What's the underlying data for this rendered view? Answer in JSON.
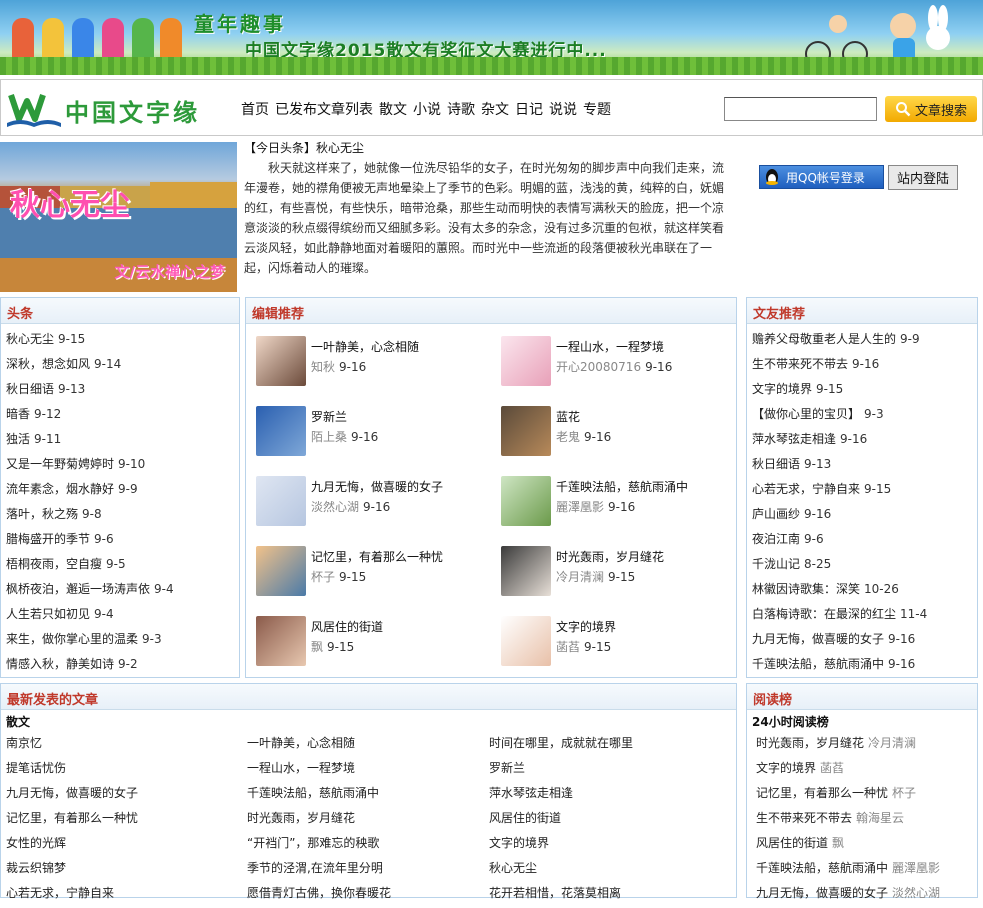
{
  "banner": {
    "title": "童年趣事",
    "subtitle": "中国文字缘2015散文有奖征文大赛进行中..."
  },
  "header": {
    "logo_text": "中国文字缘",
    "nav": [
      "首页",
      "已发布文章列表",
      "散文",
      "小说",
      "诗歌",
      "杂文",
      "日记",
      "说说",
      "专题"
    ],
    "search_placeholder": "",
    "search_button": "文章搜索",
    "qq_login": "用QQ帐号登录",
    "site_login": "站内登陆"
  },
  "headline": {
    "image_title": "秋心无尘",
    "image_author": "文/云水禅心之梦",
    "tag": "【今日头条】秋心无尘",
    "body": "秋天就这样来了，她就像一位洗尽铅华的女子，在时光匆匆的脚步声中向我们走来，流年漫卷，她的襟角便被无声地晕染上了季节的色彩。明媚的蓝，浅浅的黄，纯粹的白，妩媚的红，有些喜悦，有些快乐，暗带沧桑，那些生动而明快的表情写满秋天的脸庞，把一个凉意淡淡的秋点缀得缤纷而又细腻多彩。没有太多的杂念，没有过多沉重的包袱，就这样笑看云淡风轻，如此静静地面对着暖阳的蕙照。而时光中一些流逝的段落便被秋光串联在了一起，闪烁着动人的璀璨。"
  },
  "toutiao": {
    "title": "头条",
    "items": [
      {
        "t": "秋心无尘",
        "d": "9-15"
      },
      {
        "t": "深秋，想念如风",
        "d": "9-14"
      },
      {
        "t": "秋日细语",
        "d": "9-13"
      },
      {
        "t": "暗香",
        "d": "9-12"
      },
      {
        "t": "独活",
        "d": "9-11"
      },
      {
        "t": "又是一年野菊娉婷时",
        "d": "9-10"
      },
      {
        "t": "流年素念，烟水静好",
        "d": "9-9"
      },
      {
        "t": "落叶，秋之殇",
        "d": "9-8"
      },
      {
        "t": "腊梅盛开的季节",
        "d": "9-6"
      },
      {
        "t": "梧桐夜雨，空自瘦",
        "d": "9-5"
      },
      {
        "t": "枫桥夜泊，邂逅一场涛声依",
        "d": "9-4"
      },
      {
        "t": "人生若只如初见",
        "d": "9-4"
      },
      {
        "t": "来生，做你掌心里的温柔",
        "d": "9-3"
      },
      {
        "t": "情感入秋，静美如诗",
        "d": "9-2"
      }
    ]
  },
  "editor": {
    "title": "编辑推荐",
    "items": [
      {
        "t": "一叶静美，心念相随",
        "a": "知秋",
        "d": "9-16"
      },
      {
        "t": "一程山水，一程梦境",
        "a": "开心20080716",
        "d": "9-16"
      },
      {
        "t": "罗新兰",
        "a": "陌上桑",
        "d": "9-16"
      },
      {
        "t": "蓝花",
        "a": "老鬼",
        "d": "9-16"
      },
      {
        "t": "九月无悔，做喜暖的女子",
        "a": "淡然心湖",
        "d": "9-16"
      },
      {
        "t": "千莲映法船，慈航雨涌中",
        "a": "麗澤凰影",
        "d": "9-16"
      },
      {
        "t": "记忆里，有着那么一种忧",
        "a": "杯子",
        "d": "9-15"
      },
      {
        "t": "时光轰雨，岁月缝花",
        "a": "冷月清澜",
        "d": "9-15"
      },
      {
        "t": "风居住的街道",
        "a": "飘",
        "d": "9-15"
      },
      {
        "t": "文字的境界",
        "a": "菡萏",
        "d": "9-15"
      }
    ]
  },
  "friends": {
    "title": "文友推荐",
    "items": [
      {
        "t": "赡养父母敬重老人是人生的",
        "d": "9-9"
      },
      {
        "t": "生不带来死不带去",
        "d": "9-16"
      },
      {
        "t": "文字的境界",
        "d": "9-15"
      },
      {
        "t": "【做你心里的宝贝】",
        "d": "9-3"
      },
      {
        "t": "萍水琴弦走相逢",
        "d": "9-16"
      },
      {
        "t": "秋日细语",
        "d": "9-13"
      },
      {
        "t": "心若无求，宁静自来",
        "d": "9-15"
      },
      {
        "t": "庐山画纱",
        "d": "9-16"
      },
      {
        "t": "夜泊江南",
        "d": "9-6"
      },
      {
        "t": "千泷山记",
        "d": "8-25"
      },
      {
        "t": "林徽因诗歌集：深笑",
        "d": "10-26"
      },
      {
        "t": "白落梅诗歌：在最深的红尘",
        "d": "11-4"
      },
      {
        "t": "九月无悔，做喜暖的女子",
        "d": "9-16"
      },
      {
        "t": "千莲映法船，慈航雨涌中",
        "d": "9-16"
      }
    ]
  },
  "latest": {
    "title": "最新发表的文章",
    "category": "散文",
    "col1": [
      "南京忆",
      "提笔话忧伤",
      "九月无悔，做喜暖的女子",
      "记忆里，有着那么一种忧",
      "女性的光辉",
      "裁云织锦梦",
      "心若无求，宁静自来"
    ],
    "col2": [
      "一叶静美，心念相随",
      "一程山水，一程梦境",
      "千莲映法船，慈航雨涌中",
      "时光轰雨，岁月缝花",
      "“开裆门”，那难忘的秧歌",
      "季节的泾渭,在流年里分明",
      "愿借青灯古佛，换你春暖花"
    ],
    "col3": [
      "时间在哪里，成就就在哪里",
      "罗新兰",
      "萍水琴弦走相逢",
      "风居住的街道",
      "文字的境界",
      "秋心无尘",
      "花开若相惜，花落莫相离"
    ]
  },
  "ranking": {
    "title": "阅读榜",
    "sub": "24小时阅读榜",
    "items": [
      {
        "t": "时光轰雨，岁月缝花",
        "a": "冷月清澜"
      },
      {
        "t": "文字的境界",
        "a": "菡萏"
      },
      {
        "t": "记忆里，有着那么一种忧",
        "a": "杯子"
      },
      {
        "t": "生不带来死不带去",
        "a": "翰海星云"
      },
      {
        "t": "风居住的街道",
        "a": "飘"
      },
      {
        "t": "千莲映法船，慈航雨涌中",
        "a": "麗澤凰影"
      },
      {
        "t": "九月无悔，做喜暖的女子",
        "a": "淡然心湖"
      }
    ]
  }
}
